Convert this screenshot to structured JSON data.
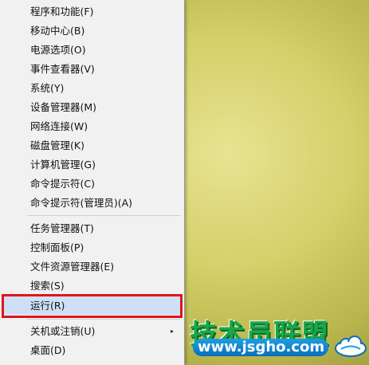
{
  "menu": {
    "items": [
      {
        "label": "程序和功能(F)"
      },
      {
        "label": "移动中心(B)"
      },
      {
        "label": "电源选项(O)"
      },
      {
        "label": "事件查看器(V)"
      },
      {
        "label": "系统(Y)"
      },
      {
        "label": "设备管理器(M)"
      },
      {
        "label": "网络连接(W)"
      },
      {
        "label": "磁盘管理(K)"
      },
      {
        "label": "计算机管理(G)"
      },
      {
        "label": "命令提示符(C)"
      },
      {
        "label": "命令提示符(管理员)(A)"
      },
      {
        "label": "任务管理器(T)"
      },
      {
        "label": "控制面板(P)"
      },
      {
        "label": "文件资源管理器(E)"
      },
      {
        "label": "搜索(S)"
      },
      {
        "label": "运行(R)",
        "highlighted": true
      },
      {
        "label": "关机或注销(U)",
        "has_submenu": true
      },
      {
        "label": "桌面(D)"
      }
    ],
    "submenu_arrow": "▸"
  },
  "watermark": {
    "title": "技术员联盟",
    "url": "www.jsgho.com",
    "logo_icon": "cloud-icon"
  },
  "colors": {
    "menu_bg": "#f1f1f1",
    "highlight_bg": "#cfe0f6",
    "annotation_box": "#e2141a",
    "watermark_green": "#1aa64a",
    "watermark_blue": "#0b6fb8"
  }
}
